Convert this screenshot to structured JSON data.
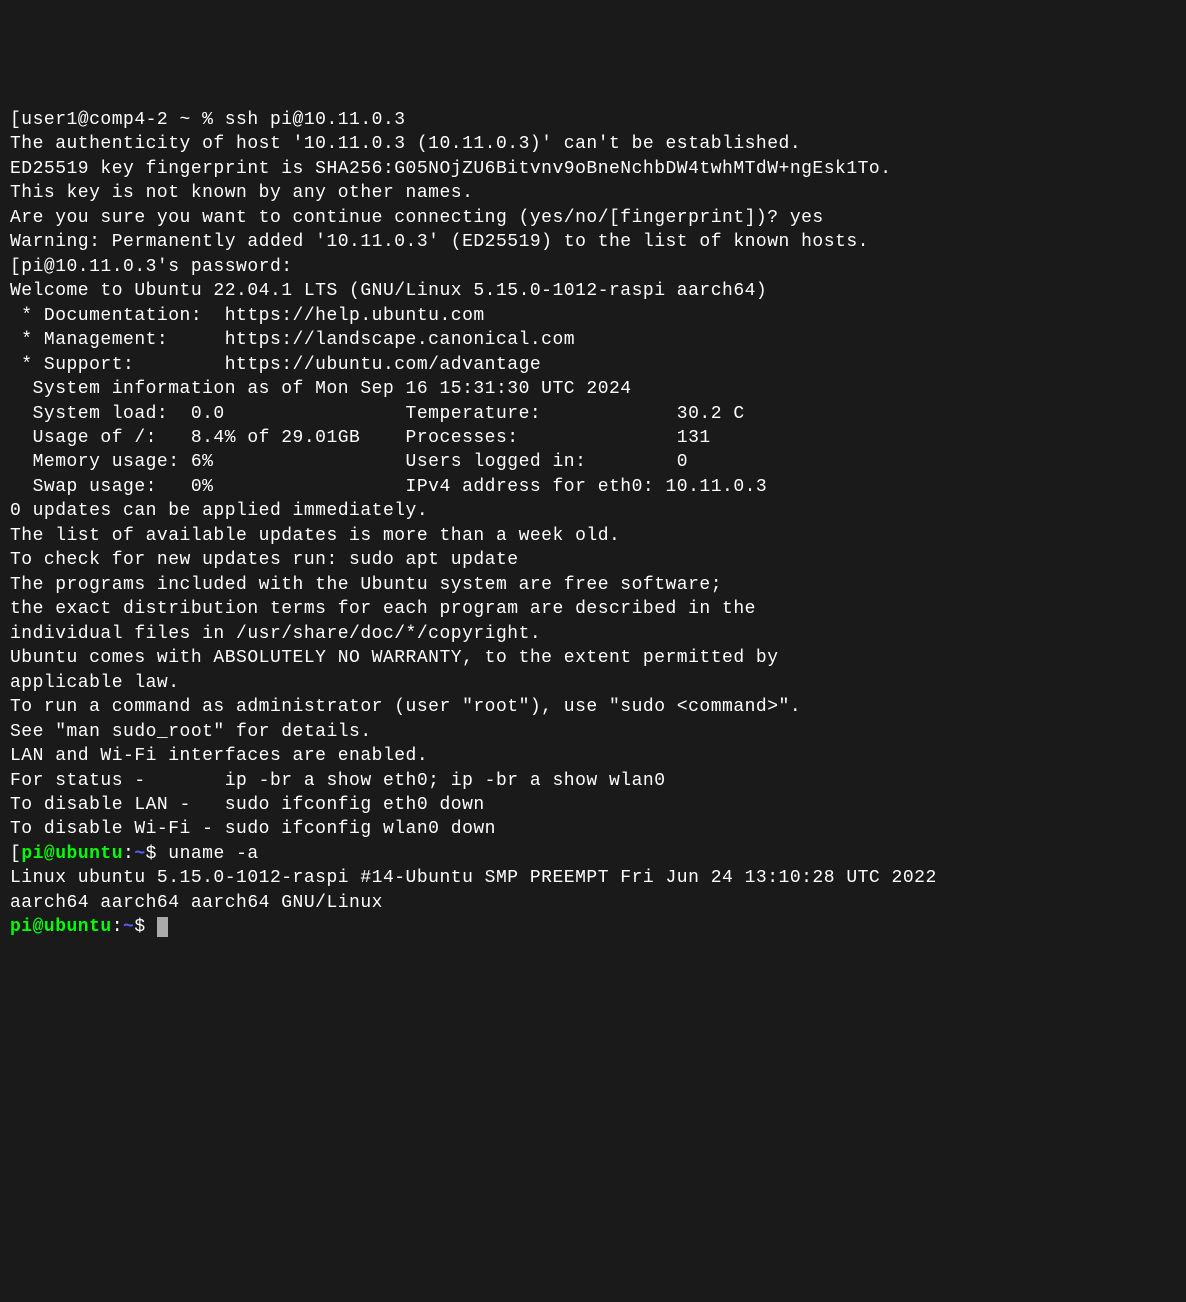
{
  "terminal": {
    "lines": [
      "[user1@comp4-2 ~ % ssh pi@10.11.0.3",
      "The authenticity of host '10.11.0.3 (10.11.0.3)' can't be established.",
      "ED25519 key fingerprint is SHA256:G05NOjZU6Bitvnv9oBneNchbDW4twhMTdW+ngEsk1To.",
      "This key is not known by any other names.",
      "Are you sure you want to continue connecting (yes/no/[fingerprint])? yes",
      "Warning: Permanently added '10.11.0.3' (ED25519) to the list of known hosts.",
      "[pi@10.11.0.3's password:",
      "Welcome to Ubuntu 22.04.1 LTS (GNU/Linux 5.15.0-1012-raspi aarch64)",
      "",
      " * Documentation:  https://help.ubuntu.com",
      " * Management:     https://landscape.canonical.com",
      " * Support:        https://ubuntu.com/advantage",
      "",
      "  System information as of Mon Sep 16 15:31:30 UTC 2024",
      "",
      "  System load:  0.0                Temperature:            30.2 C",
      "  Usage of /:   8.4% of 29.01GB    Processes:              131",
      "  Memory usage: 6%                 Users logged in:        0",
      "  Swap usage:   0%                 IPv4 address for eth0: 10.11.0.3",
      "",
      "0 updates can be applied immediately.",
      "",
      "",
      "The list of available updates is more than a week old.",
      "To check for new updates run: sudo apt update",
      "",
      "",
      "The programs included with the Ubuntu system are free software;",
      "the exact distribution terms for each program are described in the",
      "individual files in /usr/share/doc/*/copyright.",
      "",
      "Ubuntu comes with ABSOLUTELY NO WARRANTY, to the extent permitted by",
      "applicable law.",
      "",
      "To run a command as administrator (user \"root\"), use \"sudo <command>\".",
      "See \"man sudo_root\" for details.",
      "",
      "LAN and Wi-Fi interfaces are enabled.",
      "For status -       ip -br a show eth0; ip -br a show wlan0",
      "To disable LAN -   sudo ifconfig eth0 down",
      "To disable Wi-Fi - sudo ifconfig wlan0 down",
      ""
    ],
    "prompt1": {
      "bracket_open": "[",
      "user_host": "pi@ubuntu",
      "colon": ":",
      "path": "~",
      "dollar": "$ ",
      "command": "uname -a"
    },
    "uname_output": [
      "Linux ubuntu 5.15.0-1012-raspi #14-Ubuntu SMP PREEMPT Fri Jun 24 13:10:28 UTC 2022",
      "aarch64 aarch64 aarch64 GNU/Linux"
    ],
    "prompt2": {
      "user_host": "pi@ubuntu",
      "colon": ":",
      "path": "~",
      "dollar": "$ "
    }
  }
}
